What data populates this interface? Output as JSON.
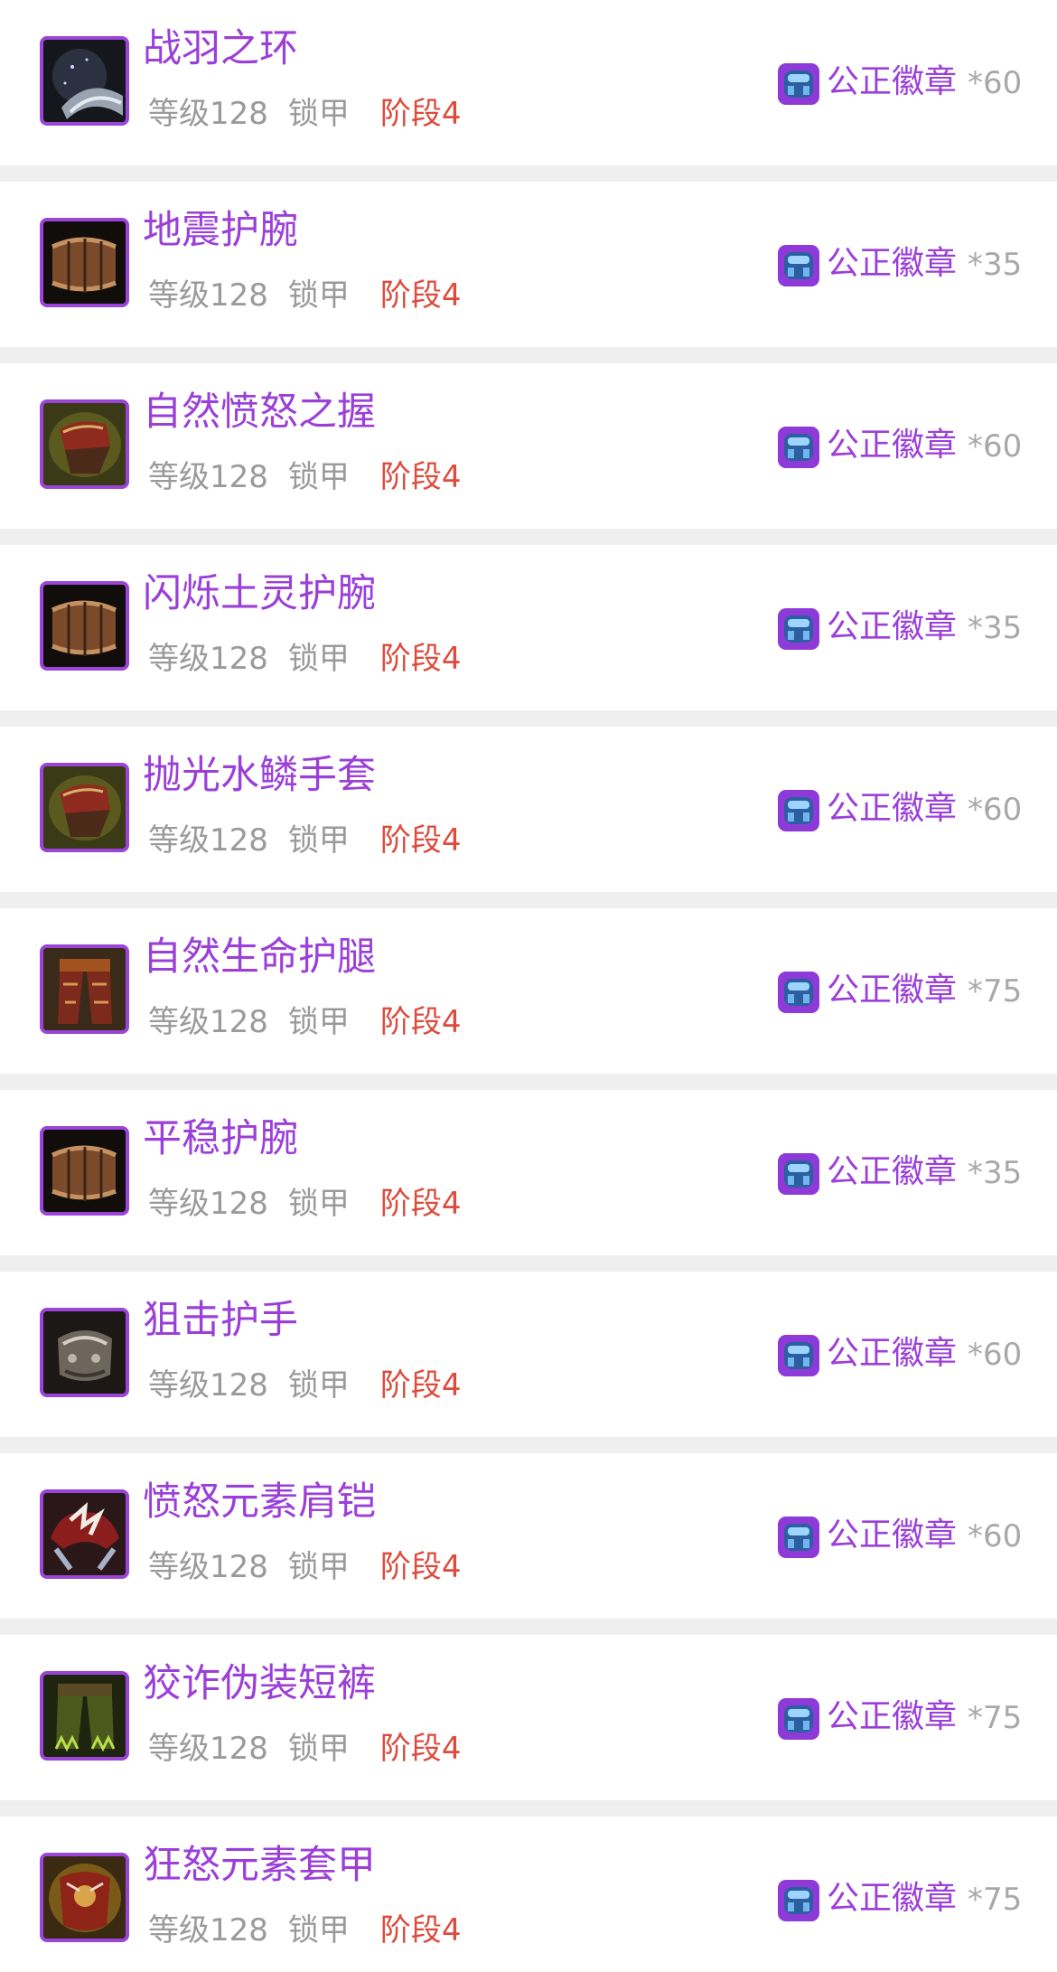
{
  "currency": {
    "name": "公正徽章",
    "icon": "justice-badge-icon"
  },
  "colors": {
    "item_name": "#9b3fd9",
    "stage": "#dd4b3c",
    "meta": "#9a9a9a",
    "frame": "#9b45d8"
  },
  "items": [
    {
      "name": "战羽之环",
      "level": "等级128",
      "armor": "锁甲",
      "stage": "阶段4",
      "price": "*60",
      "icon": "ring-icon"
    },
    {
      "name": "地震护腕",
      "level": "等级128",
      "armor": "锁甲",
      "stage": "阶段4",
      "price": "*35",
      "icon": "bracer-icon"
    },
    {
      "name": "自然愤怒之握",
      "level": "等级128",
      "armor": "锁甲",
      "stage": "阶段4",
      "price": "*60",
      "icon": "gauntlet-icon"
    },
    {
      "name": "闪烁土灵护腕",
      "level": "等级128",
      "armor": "锁甲",
      "stage": "阶段4",
      "price": "*35",
      "icon": "bracer-icon"
    },
    {
      "name": "抛光水鳞手套",
      "level": "等级128",
      "armor": "锁甲",
      "stage": "阶段4",
      "price": "*60",
      "icon": "gauntlet-icon"
    },
    {
      "name": "自然生命护腿",
      "level": "等级128",
      "armor": "锁甲",
      "stage": "阶段4",
      "price": "*75",
      "icon": "leggings-icon"
    },
    {
      "name": "平稳护腕",
      "level": "等级128",
      "armor": "锁甲",
      "stage": "阶段4",
      "price": "*35",
      "icon": "bracer-icon"
    },
    {
      "name": "狙击护手",
      "level": "等级128",
      "armor": "锁甲",
      "stage": "阶段4",
      "price": "*60",
      "icon": "metal-gauntlet-icon"
    },
    {
      "name": "愤怒元素肩铠",
      "level": "等级128",
      "armor": "锁甲",
      "stage": "阶段4",
      "price": "*60",
      "icon": "shoulder-armor-icon"
    },
    {
      "name": "狡诈伪装短裤",
      "level": "等级128",
      "armor": "锁甲",
      "stage": "阶段4",
      "price": "*75",
      "icon": "shorts-icon"
    },
    {
      "name": "狂怒元素套甲",
      "level": "等级128",
      "armor": "锁甲",
      "stage": "阶段4",
      "price": "*75",
      "icon": "chest-armor-icon"
    }
  ]
}
